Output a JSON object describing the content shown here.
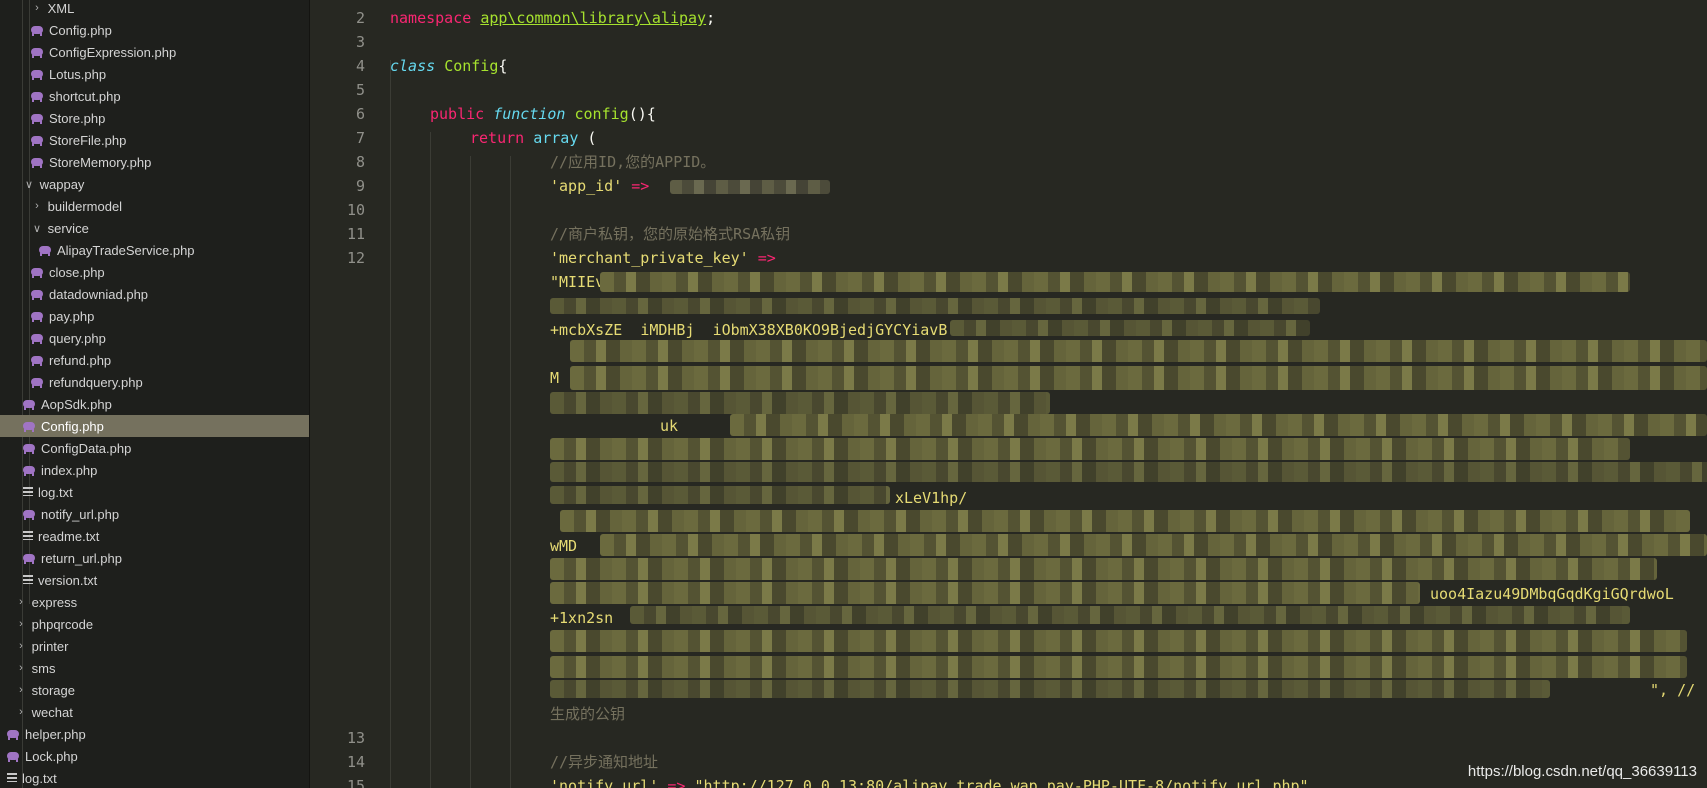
{
  "sidebar": {
    "items": [
      {
        "label": "XML",
        "type": "folder",
        "open": false,
        "indent": 2
      },
      {
        "label": "Config.php",
        "type": "php",
        "indent": 2
      },
      {
        "label": "ConfigExpression.php",
        "type": "php",
        "indent": 2
      },
      {
        "label": "Lotus.php",
        "type": "php",
        "indent": 2
      },
      {
        "label": "shortcut.php",
        "type": "php",
        "indent": 2
      },
      {
        "label": "Store.php",
        "type": "php",
        "indent": 2
      },
      {
        "label": "StoreFile.php",
        "type": "php",
        "indent": 2
      },
      {
        "label": "StoreMemory.php",
        "type": "php",
        "indent": 2
      },
      {
        "label": "wappay",
        "type": "folder",
        "open": true,
        "indent": 1
      },
      {
        "label": "buildermodel",
        "type": "folder",
        "open": false,
        "indent": 2
      },
      {
        "label": "service",
        "type": "folder",
        "open": true,
        "indent": 2
      },
      {
        "label": "AlipayTradeService.php",
        "type": "php",
        "indent": 3
      },
      {
        "label": "close.php",
        "type": "php",
        "indent": 2
      },
      {
        "label": "datadowniad.php",
        "type": "php",
        "indent": 2
      },
      {
        "label": "pay.php",
        "type": "php",
        "indent": 2
      },
      {
        "label": "query.php",
        "type": "php",
        "indent": 2
      },
      {
        "label": "refund.php",
        "type": "php",
        "indent": 2
      },
      {
        "label": "refundquery.php",
        "type": "php",
        "indent": 2
      },
      {
        "label": "AopSdk.php",
        "type": "php",
        "indent": 1
      },
      {
        "label": "Config.php",
        "type": "php",
        "indent": 1,
        "selected": true
      },
      {
        "label": "ConfigData.php",
        "type": "php",
        "indent": 1
      },
      {
        "label": "index.php",
        "type": "php",
        "indent": 1
      },
      {
        "label": "log.txt",
        "type": "txt",
        "indent": 1
      },
      {
        "label": "notify_url.php",
        "type": "php",
        "indent": 1
      },
      {
        "label": "readme.txt",
        "type": "txt",
        "indent": 1
      },
      {
        "label": "return_url.php",
        "type": "php",
        "indent": 1
      },
      {
        "label": "version.txt",
        "type": "txt",
        "indent": 1
      },
      {
        "label": "express",
        "type": "folder",
        "open": false,
        "indent": 0
      },
      {
        "label": "phpqrcode",
        "type": "folder",
        "open": false,
        "indent": 0
      },
      {
        "label": "printer",
        "type": "folder",
        "open": false,
        "indent": 0
      },
      {
        "label": "sms",
        "type": "folder",
        "open": false,
        "indent": 0
      },
      {
        "label": "storage",
        "type": "folder",
        "open": false,
        "indent": 0
      },
      {
        "label": "wechat",
        "type": "folder",
        "open": false,
        "indent": 0
      },
      {
        "label": "helper.php",
        "type": "php",
        "indent": -1
      },
      {
        "label": "Lock.php",
        "type": "php",
        "indent": -1
      },
      {
        "label": "log.txt",
        "type": "txt",
        "indent": -1
      }
    ]
  },
  "editor": {
    "line_numbers": [
      "2",
      "3",
      "4",
      "5",
      "6",
      "7",
      "8",
      "9",
      "10",
      "11",
      "12",
      "13",
      "14",
      "15"
    ],
    "line_ns": {
      "keyword": "namespace",
      "path": "app\\common\\library\\alipay",
      "end": ";"
    },
    "line_class": {
      "keyword": "class",
      "name": "Config",
      "brace": "{"
    },
    "line_func": {
      "public": "public",
      "function": "function",
      "name": "config",
      "rest": "(){"
    },
    "line_return": {
      "keyword": "return",
      "array": "array",
      "rest": " ("
    },
    "comment_appid": "//应用ID,您的APPID。",
    "key_appid": "'app_id'",
    "arrow": "=>",
    "comment_private": "//商户私钥，您的原始格式RSA私钥",
    "key_private": "'merchant_private_key'",
    "frag_1": "\"MIIEv",
    "frag_2": "+mcbXsZE",
    "frag_2b": "iMDHBj",
    "frag_2c": "iObmX38XB0KO9BjedjGYCYiavB",
    "frag_3": "M",
    "frag_4": "uk",
    "frag_5": "xLeV1hp/",
    "frag_6": "wMD",
    "frag_7": "uoo4Iazu49DMbqGqdKgiGQrdwoL",
    "frag_8": "+1xn2sn",
    "frag_end": "\", //",
    "comment_pubkey": "生成的公钥",
    "comment_notify": "//异步通知地址",
    "key_notify": "'notify_url'",
    "notify_url_value": "\"http://127.0.0.13:80/alipay.trade.wap.pay-PHP-UTF-8/notify_url.php\""
  },
  "watermark": "https://blog.csdn.net/qq_36639113"
}
